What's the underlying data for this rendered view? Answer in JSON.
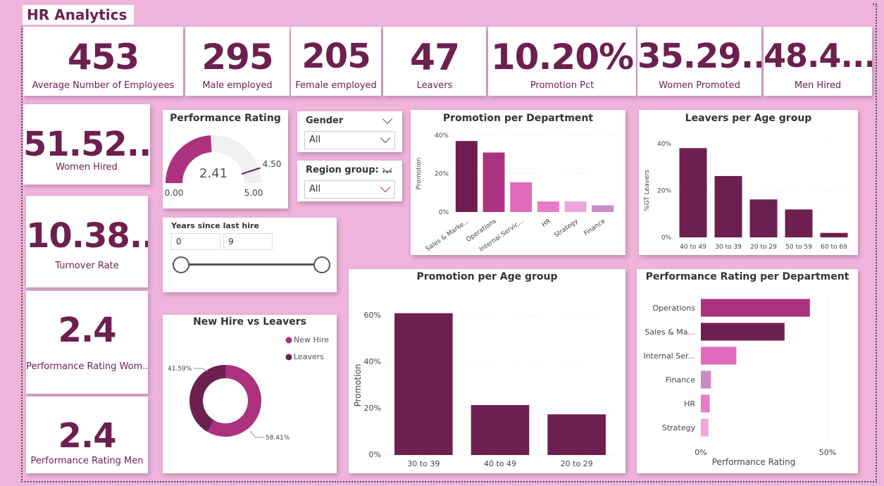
{
  "title": "HR Analytics",
  "colors": {
    "dark": "#6d1f50",
    "mid": "#ac327f",
    "pink": "#e06bbd",
    "light": "#f0a7d8",
    "lavender": "#c98cc8",
    "bg": "#efb3dc"
  },
  "kpis_top": [
    {
      "value": "453",
      "label": "Average Number of Employees"
    },
    {
      "value": "295",
      "label": "Male employed"
    },
    {
      "value": "205",
      "label": "Female employed"
    },
    {
      "value": "47",
      "label": "Leavers"
    },
    {
      "value": "10.20%",
      "label": "Promotion Pct"
    },
    {
      "value": "35.29...",
      "label": "Women Promoted"
    },
    {
      "value": "48.4...",
      "label": "Men Hired"
    }
  ],
  "kpis_side": [
    {
      "value": "51.52...",
      "label": "Women Hired"
    },
    {
      "value": "10.38...",
      "label": "Turnover Rate"
    },
    {
      "value": "2.4",
      "label": "Performance Rating Wom..."
    },
    {
      "value": "2.4",
      "label": "Performance Rating Men"
    }
  ],
  "gauge": {
    "title": "Performance Rating",
    "value": 2.41,
    "value_text": "2.41",
    "min": 0,
    "max": 5,
    "target": 4.5,
    "min_text": "0.00",
    "max_text": "5.00",
    "target_text": "4.50"
  },
  "slicers": {
    "gender": {
      "title": "Gender",
      "value": "All"
    },
    "region": {
      "title": "Region group: ...",
      "value": "All"
    },
    "years": {
      "title": "Years since last hire",
      "min": "0",
      "max": "9"
    }
  },
  "chart_data": [
    {
      "type": "bar",
      "title": "Promotion per Department",
      "ylabel": "Promotion",
      "categories": [
        "Sales & Marke...",
        "Operations",
        "Internal Servic...",
        "HR",
        "Strategy",
        "Finance"
      ],
      "values": [
        0.37,
        0.31,
        0.155,
        0.055,
        0.055,
        0.035
      ],
      "ylim": [
        0,
        0.4
      ],
      "yticks": [
        "0%",
        "20%",
        "40%"
      ],
      "colors": [
        "#6d1f50",
        "#ac327f",
        "#e06bbd",
        "#e87cc6",
        "#f0a7d8",
        "#c98cc8"
      ]
    },
    {
      "type": "bar",
      "title": "Leavers per Age group",
      "ylabel": "%GT Leavers",
      "categories": [
        "40 to 49",
        "30 to 39",
        "20 to 29",
        "50 to 59",
        "60 to 69"
      ],
      "values": [
        0.4,
        0.275,
        0.17,
        0.125,
        0.02
      ],
      "ylim": [
        0,
        0.42
      ],
      "yticks": [
        "0%",
        "20%",
        "40%"
      ]
    },
    {
      "type": "pie",
      "title": "New Hire vs Leavers",
      "legend": [
        "New Hire",
        "Leavers"
      ],
      "values": [
        58.41,
        41.59
      ],
      "labels": [
        "58.41%",
        "41.59%"
      ],
      "colors": [
        "#ac327f",
        "#6d1f50"
      ]
    },
    {
      "type": "bar",
      "title": "Promotion per Age group",
      "ylabel": "Promotion",
      "categories": [
        "30 to 39",
        "40 to 49",
        "20 to 29"
      ],
      "values": [
        0.61,
        0.215,
        0.175
      ],
      "ylim": [
        0,
        0.6
      ],
      "yticks": [
        "0%",
        "20%",
        "40%",
        "60%"
      ]
    },
    {
      "type": "bar",
      "orientation": "horizontal",
      "title": "Performance Rating per Department",
      "xlabel": "Performance Rating",
      "categories": [
        "Operations",
        "Sales & Ma...",
        "Internal Ser...",
        "Finance",
        "HR",
        "Strategy"
      ],
      "values": [
        0.43,
        0.33,
        0.14,
        0.04,
        0.035,
        0.03
      ],
      "xlim": [
        0,
        0.5
      ],
      "xticks": [
        "0%",
        "50%"
      ],
      "colors": [
        "#ac327f",
        "#6d1f50",
        "#e06bbd",
        "#c98cc8",
        "#e87cc6",
        "#f0a7d8"
      ]
    }
  ]
}
